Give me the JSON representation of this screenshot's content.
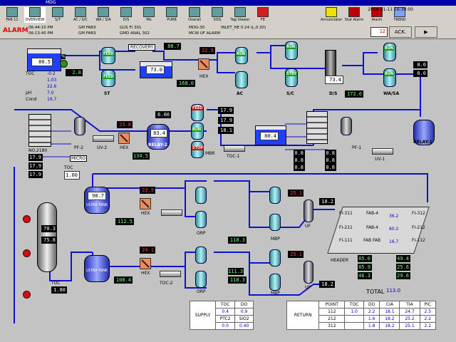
{
  "window": {
    "title": "",
    "title2": "MDG"
  },
  "toolbar": {
    "items": [
      "FAB 11",
      "OVERVIEW",
      "S/T",
      "AC / S/C",
      "WA / S/A",
      "D/S",
      "Mk",
      "PURB",
      "Overall",
      "SOG",
      "Tag Viewer",
      "FE",
      "Annunciator",
      "Stat Alarm",
      "Alarm",
      "TREND"
    ],
    "date": "2008-11-11",
    "time": "16:30:00"
  },
  "alarm": {
    "label": "ALARM",
    "lines": [
      "06:44:10 PM",
      "06:13:40 PM"
    ],
    "tags1": [
      "GM FAB3",
      "GM FAB3"
    ],
    "tags2": [
      "GUS FI 301",
      "GMD ANAL 302"
    ],
    "tags3": [
      "MDG-30",
      "MCW UF ALARM"
    ],
    "msgs": [
      "INLET_HE 0.24 (L,0.30)",
      ""
    ],
    "count": "12",
    "ack": "ACK.",
    "sound": "▶"
  },
  "process": {
    "raw_tank_level": "80.5",
    "raw_tank_unit": "%",
    "raw_flow": "2.8",
    "recovery_label": "RECOVERY",
    "recovery_flow": "88.7",
    "pit_level": "73.0",
    "pit_label": "",
    "pit_flow": "168.0",
    "hex1_temp": "22.8",
    "hex1_label": "HEX",
    "st_label": "ST",
    "ac_label": "AC",
    "sc_label": "S/C",
    "ds_level": "73.4",
    "ds_label": "D/S",
    "ds_flow": "172.0",
    "wasa_label": "WA/SA",
    "wasa_r1": "0.0",
    "wasa_r2": "0.0",
    "relay1_label": "RELAY-1",
    "toc_label": "TOC",
    "toc_rows": [
      [
        "-0.2",
        ""
      ],
      [
        "1.03",
        ""
      ],
      [
        "22.6",
        ""
      ],
      [
        "7.0",
        ""
      ],
      [
        "16.7",
        ""
      ]
    ],
    "toc_names": [
      "TOC",
      "",
      "",
      "pH",
      "Cond"
    ],
    "pf2_label": "PF-2",
    "uv2_label": "UV-2",
    "hex2_temp": "23.8",
    "hex2_label": "HEX",
    "relay2_level": "83.4",
    "relay2_label": "RELAY-2",
    "relay2_flow": "134.5",
    "mbr_pressure": "6.00",
    "mbr_label": "MBR",
    "mbr_r": [
      "17.9",
      "17.9",
      "18.1"
    ],
    "toc1_label": "TOC-1",
    "toc1_tank": "80.4",
    "pf1_label": "PF-1",
    "uv1_label": "UV-1",
    "uv1_r": [
      "0.8",
      "0.8",
      "0.8"
    ],
    "uv1_r2": [
      "0.8",
      "0.8",
      "0.8"
    ],
    "left_r": [
      "17.9",
      "17.9",
      "17.9"
    ],
    "left_r_label": "NO.2180",
    "toc_pt": "1.00",
    "toc_pt_label": "TOC",
    "micro_label": "MICRO",
    "ultra_tank1": "90.7",
    "ultra_tank1_label": "ULTRA TANK",
    "hex3_temp": "23.9",
    "hex3_label": "HEX",
    "ultra_flow1": "112.5",
    "orp1_label": "ORP",
    "mbp1_flow": "118.3",
    "mbp1_label": "MBP",
    "uf1_temp": "25.1",
    "uf1_label": "UF",
    "uf1_flow": "18.2",
    "storage_r1": "70.3",
    "storage_r2": "75.8",
    "storage_toc": "1.80",
    "storage_label": "TOC",
    "ultra_tank2": "",
    "ultra_tank2_label": "ULTRA TANK",
    "hex4_temp": "24.1",
    "hex4_label": "HEX",
    "toc2_label": "TOC-2",
    "ultra_flow2": "108.4",
    "orp2_label": "ORP",
    "mbp2_val": "111.3",
    "mbp2_flow": "118.3",
    "mbp2_label": "MBP",
    "uf2_temp": "25.1",
    "uf2_label": "UF",
    "uf2_flow": "18.2",
    "header_label": "HEADER",
    "fi": [
      {
        "name": "FI-311",
        "sub": "FAB-4",
        "val": "36.2",
        "out": "FI-312"
      },
      {
        "name": "FI-211",
        "sub": "FAB-4",
        "val": "60.2",
        "out": "FI-212"
      },
      {
        "name": "FI-111",
        "sub": "FAB FAB",
        "val": "16.7",
        "out": "FI-112"
      }
    ],
    "right_flows": [
      [
        "85.0",
        "49.4"
      ],
      [
        "85.9",
        "25.6"
      ],
      [
        "46.3",
        "29.6"
      ]
    ],
    "total_label": "TOTAL",
    "total_val": "113.0",
    "use_label": ""
  },
  "supply": {
    "title": "SUPPLY",
    "header": [
      "TOC",
      "DO"
    ],
    "rows": [
      [
        "0.4",
        "0.9"
      ],
      [
        "PTC2",
        "SiO2"
      ],
      [
        "0.0",
        "0.40"
      ]
    ]
  },
  "return": {
    "title": "RETURN",
    "header": [
      "POINT",
      "TOC",
      "DO",
      "CIA",
      "TIA",
      "PIC"
    ],
    "rows": [
      [
        "112",
        "1.0",
        "2.2",
        "18.1",
        "24.7",
        "2.5"
      ],
      [
        "212",
        "",
        "1.6",
        "18.2",
        "25.2",
        "2.2"
      ],
      [
        "312",
        "",
        "1.8",
        "18.2",
        "25.1",
        "2.1"
      ]
    ]
  },
  "colors": {
    "pipe": "#1010d0",
    "water": "#2040ff",
    "alarm": "#e00000",
    "panel": "#c3c3c3"
  }
}
